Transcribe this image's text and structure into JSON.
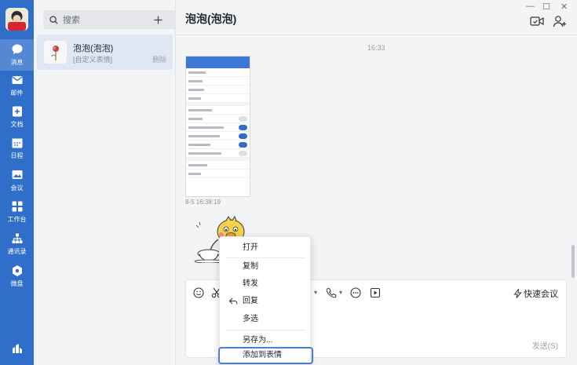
{
  "sidebar": {
    "items": [
      {
        "key": "messages",
        "label": "消息",
        "icon": "chat-bubble-icon",
        "active": true
      },
      {
        "key": "mail",
        "label": "邮件",
        "icon": "mail-icon"
      },
      {
        "key": "docs",
        "label": "文档",
        "icon": "document-icon"
      },
      {
        "key": "calendar",
        "label": "日程",
        "icon": "calendar-icon"
      },
      {
        "key": "meeting",
        "label": "会议",
        "icon": "meeting-icon"
      },
      {
        "key": "workbench",
        "label": "工作台",
        "icon": "grid-icon"
      },
      {
        "key": "contacts",
        "label": "通讯录",
        "icon": "org-chart-icon"
      },
      {
        "key": "drive",
        "label": "微盘",
        "icon": "drive-icon"
      }
    ]
  },
  "search": {
    "placeholder": "搜索"
  },
  "conversation": {
    "name": "泡泡(泡泡)",
    "preview": "[自定义表情]",
    "action": "删除"
  },
  "chat": {
    "title": "泡泡(泡泡)",
    "time_divider": "16:33",
    "image_timestamp": "8-5 16:38:19",
    "quick_meeting": "快速会议",
    "send": "发送(S)"
  },
  "context_menu": {
    "items": [
      "打开",
      "复制",
      "转发",
      "回复",
      "多选",
      "另存为...",
      "添加到表情"
    ],
    "highlighted": "添加到表情"
  },
  "colors": {
    "accent": "#2f6ec9",
    "highlight_border": "#4a7fd6"
  }
}
